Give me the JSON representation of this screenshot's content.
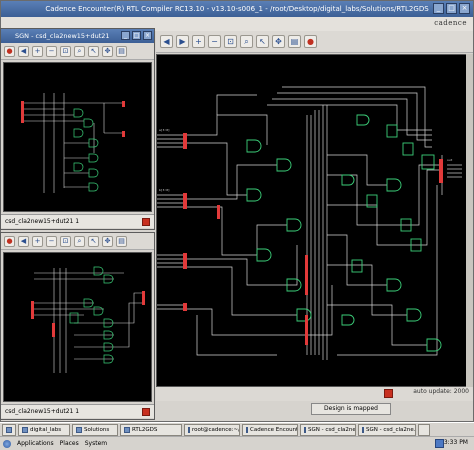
{
  "main_window": {
    "title": "Cadence Encounter(R) RTL Compiler RC13.10 - v13.10-s006_1 - /root/Desktop/digital_labs/Solutions/RTL2GDS",
    "logo": "cadence",
    "auto_update_label": "auto update: 2000",
    "design_status": "Design is mapped"
  },
  "sgn_top": {
    "title": "SGN - csd_cla2new15+dut21",
    "status": "csd_cla2new15+dut21 1"
  },
  "sgn_bottom": {
    "status": "csd_cla2new15+dut21 1"
  },
  "taskbar": {
    "items": [
      {
        "label": "digital_labs"
      },
      {
        "label": "Solutions"
      },
      {
        "label": "RTL2GDS"
      },
      {
        "label": "root@cadence:~/..."
      },
      {
        "label": "Cadence Encount..."
      },
      {
        "label": "SGN - csd_cla2ne..."
      },
      {
        "label": "SGN - csd_cla2ne..."
      }
    ],
    "menus": [
      "Applications",
      "Places",
      "System"
    ],
    "clock": "3:33 PM"
  },
  "colors": {
    "wire": "#d6d6d6",
    "gate": "#3cd07a",
    "pin": "#e23a3a",
    "canvas": "#000000",
    "titlebar": "#3c5f95"
  }
}
